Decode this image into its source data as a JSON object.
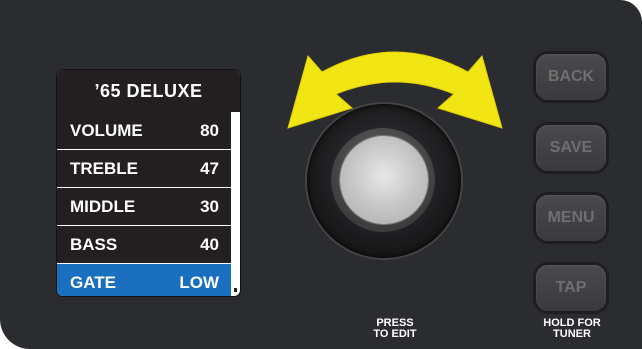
{
  "screen": {
    "title": "’65 DELUXE",
    "rows": [
      {
        "label": "VOLUME",
        "value": "80"
      },
      {
        "label": "TREBLE",
        "value": "47"
      },
      {
        "label": "MIDDLE",
        "value": "30"
      },
      {
        "label": "BASS",
        "value": "40"
      },
      {
        "label": "GATE",
        "value": "LOW"
      }
    ],
    "selected_index": 4
  },
  "knob": {
    "caption_line1": "PRESS",
    "caption_line2": "TO EDIT",
    "arrow_color": "#f2e514"
  },
  "buttons": {
    "back": "BACK",
    "save": "SAVE",
    "menu": "MENU",
    "tap": "TAP",
    "tap_caption_line1": "HOLD FOR",
    "tap_caption_line2": "TUNER"
  },
  "colors": {
    "panel": "#2b2c2f",
    "selected_row": "#1a6fbf",
    "screen_dark": "#231f20"
  }
}
